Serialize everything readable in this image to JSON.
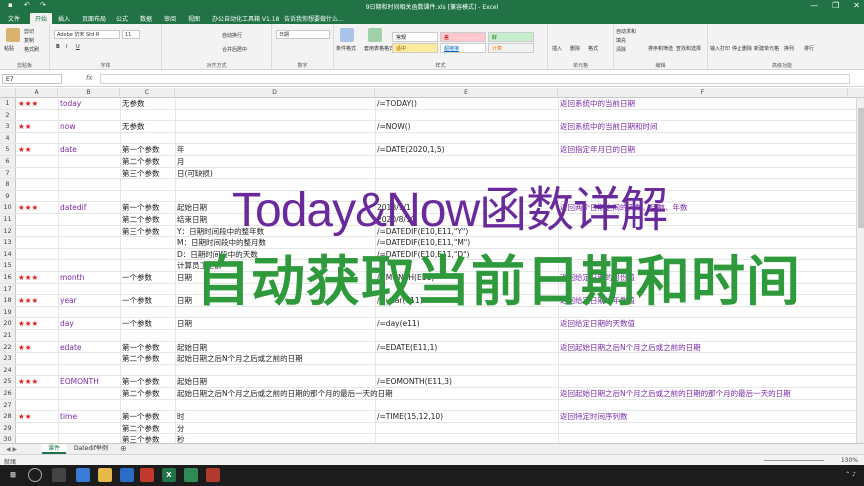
{
  "window": {
    "title": "9日期和时间相关函数课件.xls [兼容模式] - Excel",
    "controls": [
      "—",
      "❐",
      "✕"
    ]
  },
  "ribbon_tabs": [
    "文件",
    "开始",
    "插入",
    "页面布局",
    "公式",
    "数据",
    "审阅",
    "视图",
    "办公自动化工具箱 V1.18",
    "告诉我你想要做什么..."
  ],
  "ribbon": {
    "clipboard": {
      "paste": "粘贴",
      "cut": "剪切",
      "copy": "复制",
      "format_painter": "格式刷",
      "label": "剪贴板"
    },
    "font": {
      "font_name": "Adobe 仿宋 Std R",
      "font_size": "11",
      "label": "字体",
      "bold": "B",
      "italic": "I",
      "underline": "U"
    },
    "alignment": {
      "wrap": "自动换行",
      "merge": "合并后居中",
      "label": "对齐方式"
    },
    "number": {
      "format": "日期",
      "label": "数字"
    },
    "styles": {
      "conditional": "条件格式",
      "table": "套用表格格式",
      "label": "样式",
      "cells": [
        {
          "text": "常规",
          "bg": "#ffffff",
          "fg": "#000000"
        },
        {
          "text": "差",
          "bg": "#ffc7ce",
          "fg": "#9c0006"
        },
        {
          "text": "好",
          "bg": "#c6efce",
          "fg": "#006100"
        },
        {
          "text": "适中",
          "bg": "#ffeb9c",
          "fg": "#9c5700"
        },
        {
          "text": "超链接",
          "bg": "#ffffff",
          "fg": "#0563c1"
        },
        {
          "text": "计算",
          "bg": "#f2f2f2",
          "fg": "#fa7d00"
        }
      ]
    },
    "cells_group": {
      "insert": "插入",
      "delete": "删除",
      "format": "格式",
      "label": "单元格"
    },
    "editing": {
      "autosum": "自动求和",
      "fill": "填充",
      "clear": "清除",
      "sort": "排序和筛选",
      "find": "查找和选择",
      "label": "编辑"
    },
    "extra": {
      "input": "输入打印",
      "stop": "停止删除",
      "insert_sheet": "新建单元格",
      "swap": "换列",
      "sort2": "排行",
      "label": "高级功能"
    }
  },
  "formula_bar": {
    "name_box": "E7",
    "fx": "fx",
    "value": ""
  },
  "columns": [
    "A",
    "B",
    "C",
    "D",
    "E",
    "F"
  ],
  "rows": [
    {
      "n": "1",
      "a": "★★★",
      "b": "today",
      "c": "无参数",
      "d": "",
      "e": "/=TODAY()",
      "f": "返回系统中的当前日期"
    },
    {
      "n": "2",
      "a": "",
      "b": "",
      "c": "",
      "d": "",
      "e": "",
      "f": ""
    },
    {
      "n": "3",
      "a": "★★",
      "b": "now",
      "c": "无参数",
      "d": "",
      "e": "/=NOW()",
      "f": "返回系统中的当前日期和时间"
    },
    {
      "n": "4",
      "a": "",
      "b": "",
      "c": "",
      "d": "",
      "e": "",
      "f": ""
    },
    {
      "n": "5",
      "a": "★★",
      "b": "date",
      "c": "第一个参数",
      "d": "年",
      "e": "/=DATE(2020,1,5)",
      "f": "返回指定年月日的日期"
    },
    {
      "n": "6",
      "a": "",
      "b": "",
      "c": "第二个参数",
      "d": "月",
      "e": "",
      "f": ""
    },
    {
      "n": "7",
      "a": "",
      "b": "",
      "c": "第三个参数",
      "d": "日(可缺损)",
      "e": "",
      "f": ""
    },
    {
      "n": "8",
      "a": "",
      "b": "",
      "c": "",
      "d": "",
      "e": "",
      "f": ""
    },
    {
      "n": "9",
      "a": "",
      "b": "",
      "c": "",
      "d": "",
      "e": "",
      "f": ""
    },
    {
      "n": "10",
      "a": "★★★",
      "b": "datedif",
      "c": "第一个参数",
      "d": "起始日期",
      "e": "2018/1/1",
      "f": "返回两个日期之间的天数、月数、年数"
    },
    {
      "n": "11",
      "a": "",
      "b": "",
      "c": "第二个参数",
      "d": "结束日期",
      "e": "2020/8/10",
      "f": ""
    },
    {
      "n": "12",
      "a": "",
      "b": "",
      "c": "第三个参数",
      "d": "Y：日期时间段中的整年数",
      "e": "/=DATEDIF(E10,E11,\"Y\")",
      "f": ""
    },
    {
      "n": "13",
      "a": "",
      "b": "",
      "c": "",
      "d": "M：日期时间段中的整月数",
      "e": "/=DATEDIF(E10,E11,\"M\")",
      "f": ""
    },
    {
      "n": "14",
      "a": "",
      "b": "",
      "c": "",
      "d": "D：日期时间段中的天数",
      "e": "/=DATEDIF(E10,E11,\"D\")",
      "f": ""
    },
    {
      "n": "15",
      "a": "",
      "b": "",
      "c": "",
      "d": "计算员工工龄",
      "e": "",
      "f": ""
    },
    {
      "n": "16",
      "a": "★★★",
      "b": "month",
      "c": "一个参数",
      "d": "日期",
      "e": "/=MONTH(E11)",
      "f": "返回给定日期的月份值"
    },
    {
      "n": "17",
      "a": "",
      "b": "",
      "c": "",
      "d": "",
      "e": "",
      "f": ""
    },
    {
      "n": "18",
      "a": "★★★",
      "b": "year",
      "c": "一个参数",
      "d": "日期",
      "e": "/=year(e11)",
      "f": "返回给定日期的年数值"
    },
    {
      "n": "19",
      "a": "",
      "b": "",
      "c": "",
      "d": "",
      "e": "",
      "f": ""
    },
    {
      "n": "20",
      "a": "★★★",
      "b": "day",
      "c": "一个参数",
      "d": "日期",
      "e": "/=day(e11)",
      "f": "返回给定日期的天数值"
    },
    {
      "n": "21",
      "a": "",
      "b": "",
      "c": "",
      "d": "",
      "e": "",
      "f": ""
    },
    {
      "n": "22",
      "a": "★★",
      "b": "edate",
      "c": "第一个参数",
      "d": "起始日期",
      "e": "/=EDATE(E11,1)",
      "f": "返回起始日期之后N个月之后或之前的日期"
    },
    {
      "n": "23",
      "a": "",
      "b": "",
      "c": "第二个参数",
      "d": "起始日期之后N个月之后或之前的日期",
      "e": "",
      "f": ""
    },
    {
      "n": "24",
      "a": "",
      "b": "",
      "c": "",
      "d": "",
      "e": "",
      "f": ""
    },
    {
      "n": "25",
      "a": "★★★",
      "b": "EOMONTH",
      "c": "第一个参数",
      "d": "起始日期",
      "e": "/=EOMONTH(E11,3)",
      "f": ""
    },
    {
      "n": "26",
      "a": "",
      "b": "",
      "c": "第二个参数",
      "d": "起始日期之后N个月之后或之前的日期的那个月的最后一天的日期",
      "e": "",
      "f": "返回起始日期之后N个月之后或之前的日期的那个月的最后一天的日期"
    },
    {
      "n": "27",
      "a": "",
      "b": "",
      "c": "",
      "d": "",
      "e": "",
      "f": ""
    },
    {
      "n": "28",
      "a": "★★",
      "b": "time",
      "c": "第一个参数",
      "d": "时",
      "e": "/=TIME(15,12,10)",
      "f": "返回特定时间序列数"
    },
    {
      "n": "29",
      "a": "",
      "b": "",
      "c": "第二个参数",
      "d": "分",
      "e": "",
      "f": ""
    },
    {
      "n": "30",
      "a": "",
      "b": "",
      "c": "第三个参数",
      "d": "秒",
      "e": "",
      "f": ""
    }
  ],
  "sheets": [
    "课件",
    "Datedif举例"
  ],
  "status": {
    "ready": "就绪",
    "zoom": "130%"
  },
  "overlay": {
    "line1": "Today&Now函数详解",
    "line2": "自动获取当前日期和时间"
  }
}
